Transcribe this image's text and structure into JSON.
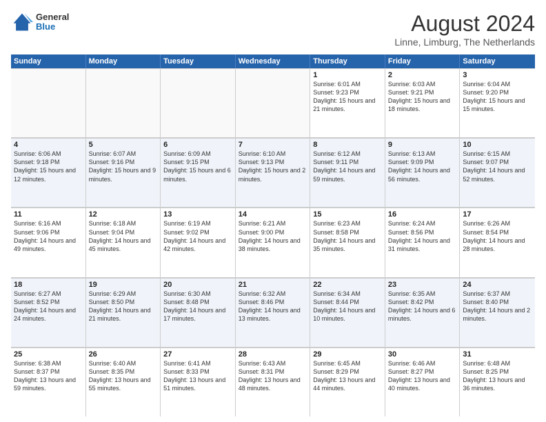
{
  "header": {
    "logo": {
      "general": "General",
      "blue": "Blue"
    },
    "title": "August 2024",
    "location": "Linne, Limburg, The Netherlands"
  },
  "days_of_week": [
    "Sunday",
    "Monday",
    "Tuesday",
    "Wednesday",
    "Thursday",
    "Friday",
    "Saturday"
  ],
  "rows": [
    {
      "alt": false,
      "cells": [
        {
          "day": "",
          "empty": true
        },
        {
          "day": "",
          "empty": true
        },
        {
          "day": "",
          "empty": true
        },
        {
          "day": "",
          "empty": true
        },
        {
          "day": "1",
          "empty": false,
          "text": "Sunrise: 6:01 AM\nSunset: 9:23 PM\nDaylight: 15 hours and 21 minutes."
        },
        {
          "day": "2",
          "empty": false,
          "text": "Sunrise: 6:03 AM\nSunset: 9:21 PM\nDaylight: 15 hours and 18 minutes."
        },
        {
          "day": "3",
          "empty": false,
          "text": "Sunrise: 6:04 AM\nSunset: 9:20 PM\nDaylight: 15 hours and 15 minutes."
        }
      ]
    },
    {
      "alt": true,
      "cells": [
        {
          "day": "4",
          "empty": false,
          "text": "Sunrise: 6:06 AM\nSunset: 9:18 PM\nDaylight: 15 hours and 12 minutes."
        },
        {
          "day": "5",
          "empty": false,
          "text": "Sunrise: 6:07 AM\nSunset: 9:16 PM\nDaylight: 15 hours and 9 minutes."
        },
        {
          "day": "6",
          "empty": false,
          "text": "Sunrise: 6:09 AM\nSunset: 9:15 PM\nDaylight: 15 hours and 6 minutes."
        },
        {
          "day": "7",
          "empty": false,
          "text": "Sunrise: 6:10 AM\nSunset: 9:13 PM\nDaylight: 15 hours and 2 minutes."
        },
        {
          "day": "8",
          "empty": false,
          "text": "Sunrise: 6:12 AM\nSunset: 9:11 PM\nDaylight: 14 hours and 59 minutes."
        },
        {
          "day": "9",
          "empty": false,
          "text": "Sunrise: 6:13 AM\nSunset: 9:09 PM\nDaylight: 14 hours and 56 minutes."
        },
        {
          "day": "10",
          "empty": false,
          "text": "Sunrise: 6:15 AM\nSunset: 9:07 PM\nDaylight: 14 hours and 52 minutes."
        }
      ]
    },
    {
      "alt": false,
      "cells": [
        {
          "day": "11",
          "empty": false,
          "text": "Sunrise: 6:16 AM\nSunset: 9:06 PM\nDaylight: 14 hours and 49 minutes."
        },
        {
          "day": "12",
          "empty": false,
          "text": "Sunrise: 6:18 AM\nSunset: 9:04 PM\nDaylight: 14 hours and 45 minutes."
        },
        {
          "day": "13",
          "empty": false,
          "text": "Sunrise: 6:19 AM\nSunset: 9:02 PM\nDaylight: 14 hours and 42 minutes."
        },
        {
          "day": "14",
          "empty": false,
          "text": "Sunrise: 6:21 AM\nSunset: 9:00 PM\nDaylight: 14 hours and 38 minutes."
        },
        {
          "day": "15",
          "empty": false,
          "text": "Sunrise: 6:23 AM\nSunset: 8:58 PM\nDaylight: 14 hours and 35 minutes."
        },
        {
          "day": "16",
          "empty": false,
          "text": "Sunrise: 6:24 AM\nSunset: 8:56 PM\nDaylight: 14 hours and 31 minutes."
        },
        {
          "day": "17",
          "empty": false,
          "text": "Sunrise: 6:26 AM\nSunset: 8:54 PM\nDaylight: 14 hours and 28 minutes."
        }
      ]
    },
    {
      "alt": true,
      "cells": [
        {
          "day": "18",
          "empty": false,
          "text": "Sunrise: 6:27 AM\nSunset: 8:52 PM\nDaylight: 14 hours and 24 minutes."
        },
        {
          "day": "19",
          "empty": false,
          "text": "Sunrise: 6:29 AM\nSunset: 8:50 PM\nDaylight: 14 hours and 21 minutes."
        },
        {
          "day": "20",
          "empty": false,
          "text": "Sunrise: 6:30 AM\nSunset: 8:48 PM\nDaylight: 14 hours and 17 minutes."
        },
        {
          "day": "21",
          "empty": false,
          "text": "Sunrise: 6:32 AM\nSunset: 8:46 PM\nDaylight: 14 hours and 13 minutes."
        },
        {
          "day": "22",
          "empty": false,
          "text": "Sunrise: 6:34 AM\nSunset: 8:44 PM\nDaylight: 14 hours and 10 minutes."
        },
        {
          "day": "23",
          "empty": false,
          "text": "Sunrise: 6:35 AM\nSunset: 8:42 PM\nDaylight: 14 hours and 6 minutes."
        },
        {
          "day": "24",
          "empty": false,
          "text": "Sunrise: 6:37 AM\nSunset: 8:40 PM\nDaylight: 14 hours and 2 minutes."
        }
      ]
    },
    {
      "alt": false,
      "cells": [
        {
          "day": "25",
          "empty": false,
          "text": "Sunrise: 6:38 AM\nSunset: 8:37 PM\nDaylight: 13 hours and 59 minutes."
        },
        {
          "day": "26",
          "empty": false,
          "text": "Sunrise: 6:40 AM\nSunset: 8:35 PM\nDaylight: 13 hours and 55 minutes."
        },
        {
          "day": "27",
          "empty": false,
          "text": "Sunrise: 6:41 AM\nSunset: 8:33 PM\nDaylight: 13 hours and 51 minutes."
        },
        {
          "day": "28",
          "empty": false,
          "text": "Sunrise: 6:43 AM\nSunset: 8:31 PM\nDaylight: 13 hours and 48 minutes."
        },
        {
          "day": "29",
          "empty": false,
          "text": "Sunrise: 6:45 AM\nSunset: 8:29 PM\nDaylight: 13 hours and 44 minutes."
        },
        {
          "day": "30",
          "empty": false,
          "text": "Sunrise: 6:46 AM\nSunset: 8:27 PM\nDaylight: 13 hours and 40 minutes."
        },
        {
          "day": "31",
          "empty": false,
          "text": "Sunrise: 6:48 AM\nSunset: 8:25 PM\nDaylight: 13 hours and 36 minutes."
        }
      ]
    }
  ]
}
